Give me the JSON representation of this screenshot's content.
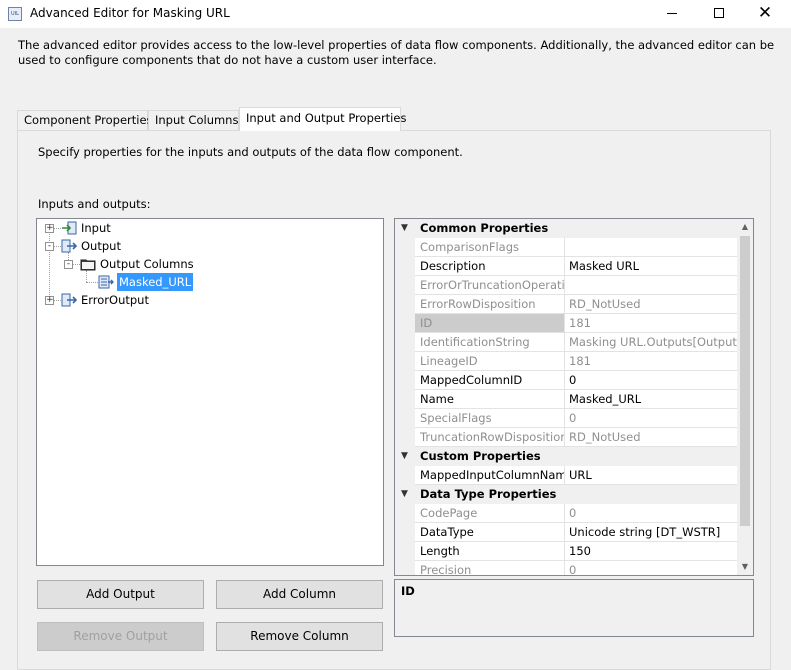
{
  "window": {
    "title": "Advanced Editor for Masking URL",
    "icon_text": "UIL"
  },
  "description": "The advanced editor provides access to the low-level properties of data flow components. Additionally, the advanced editor can be used to configure components that do not have a custom user interface.",
  "tabs": [
    {
      "label": "Component Properties",
      "active": false
    },
    {
      "label": "Input Columns",
      "active": false
    },
    {
      "label": "Input and Output Properties",
      "active": true
    }
  ],
  "panel": {
    "description": "Specify properties for the inputs and outputs of the data flow component.",
    "inputs_outputs_label": "Inputs and outputs:"
  },
  "tree": [
    {
      "label": "Input",
      "expander": "+",
      "icon": "input-icon"
    },
    {
      "label": "Output",
      "expander": "-",
      "icon": "output-icon"
    },
    {
      "label": "Output Columns",
      "expander": "-",
      "icon": "folder-icon"
    },
    {
      "label": "Masked_URL",
      "icon": "column-icon",
      "selected": true
    },
    {
      "label": "ErrorOutput",
      "expander": "+",
      "icon": "output-icon"
    }
  ],
  "buttons": {
    "add_output": "Add Output",
    "add_column": "Add Column",
    "remove_output": "Remove Output",
    "remove_column": "Remove Column"
  },
  "properties": {
    "categories": [
      {
        "name": "Common Properties",
        "rows": [
          {
            "name": "ComparisonFlags",
            "value": "",
            "readonly": true
          },
          {
            "name": "Description",
            "value": "Masked URL",
            "readonly": false
          },
          {
            "name": "ErrorOrTruncationOperation",
            "value": "",
            "readonly": true
          },
          {
            "name": "ErrorRowDisposition",
            "value": "RD_NotUsed",
            "readonly": true
          },
          {
            "name": "ID",
            "value": "181",
            "readonly": true,
            "selected": true
          },
          {
            "name": "IdentificationString",
            "value": "Masking URL.Outputs[Output].Columns[Masked_URL]",
            "readonly": true
          },
          {
            "name": "LineageID",
            "value": "181",
            "readonly": true
          },
          {
            "name": "MappedColumnID",
            "value": "0",
            "readonly": false
          },
          {
            "name": "Name",
            "value": "Masked_URL",
            "readonly": false
          },
          {
            "name": "SpecialFlags",
            "value": "0",
            "readonly": true
          },
          {
            "name": "TruncationRowDisposition",
            "value": "RD_NotUsed",
            "readonly": true
          }
        ]
      },
      {
        "name": "Custom Properties",
        "rows": [
          {
            "name": "MappedInputColumnName",
            "value": "URL",
            "readonly": false
          }
        ]
      },
      {
        "name": "Data Type Properties",
        "rows": [
          {
            "name": "CodePage",
            "value": "0",
            "readonly": true
          },
          {
            "name": "DataType",
            "value": "Unicode string [DT_WSTR]",
            "readonly": false
          },
          {
            "name": "Length",
            "value": "150",
            "readonly": false
          },
          {
            "name": "Precision",
            "value": "0",
            "readonly": true
          }
        ]
      }
    ]
  },
  "property_description": {
    "title": "ID"
  },
  "colors": {
    "selection": "#3399ff",
    "readonly_text": "#8f8f8f",
    "category_bg": "#f0f0f0"
  }
}
